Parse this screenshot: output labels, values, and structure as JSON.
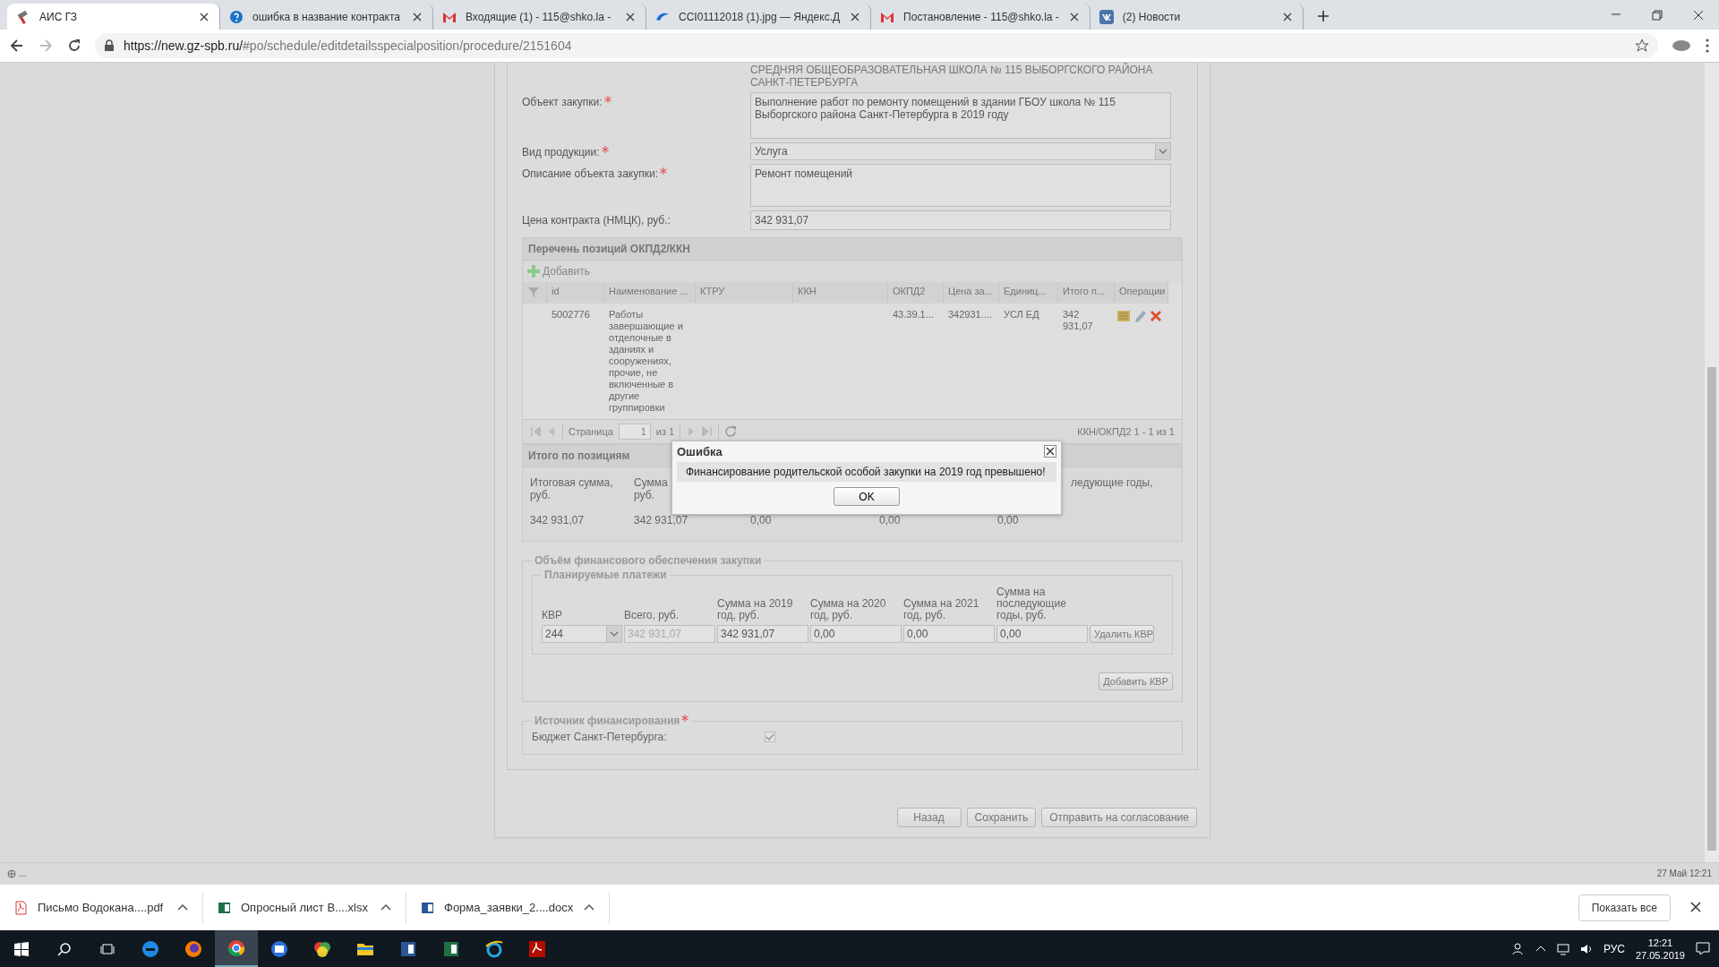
{
  "browser": {
    "tabs": [
      {
        "title": "АИС ГЗ",
        "kind": "gavel",
        "selected": true
      },
      {
        "title": "ошибка в название контракта",
        "kind": "help",
        "selected": false
      },
      {
        "title": "Входящие (1) - 115@shko.la -",
        "kind": "mail",
        "selected": false
      },
      {
        "title": "CCI01112018 (1).jpg — Яндекс.Д",
        "kind": "disk",
        "selected": false
      },
      {
        "title": "Постановление - 115@shko.la -",
        "kind": "mail",
        "selected": false
      },
      {
        "title": "(2) Новости",
        "kind": "vk",
        "selected": false
      }
    ],
    "url_host": "https://new.gz-spb.ru/",
    "url_path": "#po/schedule/editdetailsspecialposition/procedure/2151604"
  },
  "form": {
    "header_text": "СРЕДНЯЯ ОБЩЕОБРАЗОВАТЕЛЬНАЯ ШКОЛА № 115 ВЫБОРГСКОГО РАЙОНА САНКТ-ПЕТЕРБУРГА",
    "fields": [
      {
        "label": "Объект закупки:",
        "required": true,
        "kind": "textarea",
        "value": "Выполнение работ по ремонту помещений в здании ГБОУ школа № 115 Выборгского района Санкт-Петербурга в 2019 году"
      },
      {
        "label": "Вид продукции:",
        "required": true,
        "kind": "select",
        "value": "Услуга"
      },
      {
        "label": "Описание объекта закупки:",
        "required": true,
        "kind": "textarea",
        "value": "Ремонт помещений"
      },
      {
        "label": "Цена контракта (НМЦК), руб.:",
        "required": false,
        "kind": "input",
        "value": "342 931,07"
      }
    ]
  },
  "positions": {
    "title": "Перечень позиций ОКПД2/ККН",
    "add_label": "Добавить",
    "columns": [
      "id",
      "Наименование ...",
      "КТРУ",
      "ККН",
      "ОКПД2",
      "Цена за...",
      "Единиц...",
      "Итого п...",
      "Операции"
    ],
    "rows": [
      {
        "cells": [
          "5002776",
          "Работы завершающие и отделочные в зданиях и сооружениях, прочие, не включенные в другие группировки",
          "",
          "",
          "43.39.1...",
          "342931....",
          "УСЛ ЕД",
          "342 931,07"
        ]
      }
    ],
    "pager": {
      "page_label": "Страница",
      "page": "1",
      "of": "из 1",
      "summary": "ККН/ОКПД2 1 - 1 из 1"
    }
  },
  "totals": {
    "title": "Итого по позициям",
    "items": [
      {
        "label": "Итоговая сумма, руб.",
        "value": "342 931,07"
      },
      {
        "label": "Сумма руб.",
        "value": "342 931,07"
      },
      {
        "value": "0,00"
      },
      {
        "value": "0,00"
      },
      {
        "label": "ледующие годы,",
        "value": "0,00"
      }
    ]
  },
  "finance": {
    "title": "Объём финансового обеспечения закупки",
    "subtitle": "Планируемые платежи",
    "columns": [
      "КВР",
      "Всего, руб.",
      "Сумма на 2019 год, руб.",
      "Сумма на 2020 год, руб.",
      "Сумма на 2021 год, руб.",
      "Сумма на последующие годы, руб."
    ],
    "rows": [
      {
        "kvr": "244",
        "total": "342 931,07",
        "values": [
          "342 931,07",
          "0,00",
          "0,00",
          "0,00"
        ],
        "delete_label": "Удалить КВР"
      }
    ],
    "add_label": "Добавить КВР"
  },
  "source": {
    "title": "Источник финансирования",
    "required": true,
    "items": [
      {
        "label": "Бюджет Санкт-Петербурга:",
        "checked": true
      }
    ]
  },
  "actions": [
    "Назад",
    "Сохранить",
    "Отправить на согласование"
  ],
  "dialog": {
    "title": "Ошибка",
    "message": "Финансирование родительской особой закупки на 2019 год превышено!",
    "button": "OK"
  },
  "status": {
    "left": "...",
    "right": "27 Май 12:21"
  },
  "downloads": {
    "items": [
      {
        "name": "Письмо Водокана....pdf",
        "kind": "pdf"
      },
      {
        "name": "Опросный лист В....xlsx",
        "kind": "xlsx"
      },
      {
        "name": "Форма_заявки_2....docx",
        "kind": "docx"
      }
    ],
    "show_all": "Показать все"
  },
  "taskbar": {
    "apps": [
      {
        "kind": "edge",
        "selected": false
      },
      {
        "kind": "firefox",
        "selected": false
      },
      {
        "kind": "chrome",
        "selected": true
      },
      {
        "kind": "mailapp",
        "selected": false
      },
      {
        "kind": "colorwheel",
        "selected": false
      },
      {
        "kind": "folder",
        "selected": false
      },
      {
        "kind": "word",
        "selected": false
      },
      {
        "kind": "excel",
        "selected": false
      },
      {
        "kind": "ie",
        "selected": false
      },
      {
        "kind": "acrobat",
        "selected": false
      }
    ],
    "lang": "РУС",
    "time": "12:21",
    "date": "27.05.2019"
  }
}
